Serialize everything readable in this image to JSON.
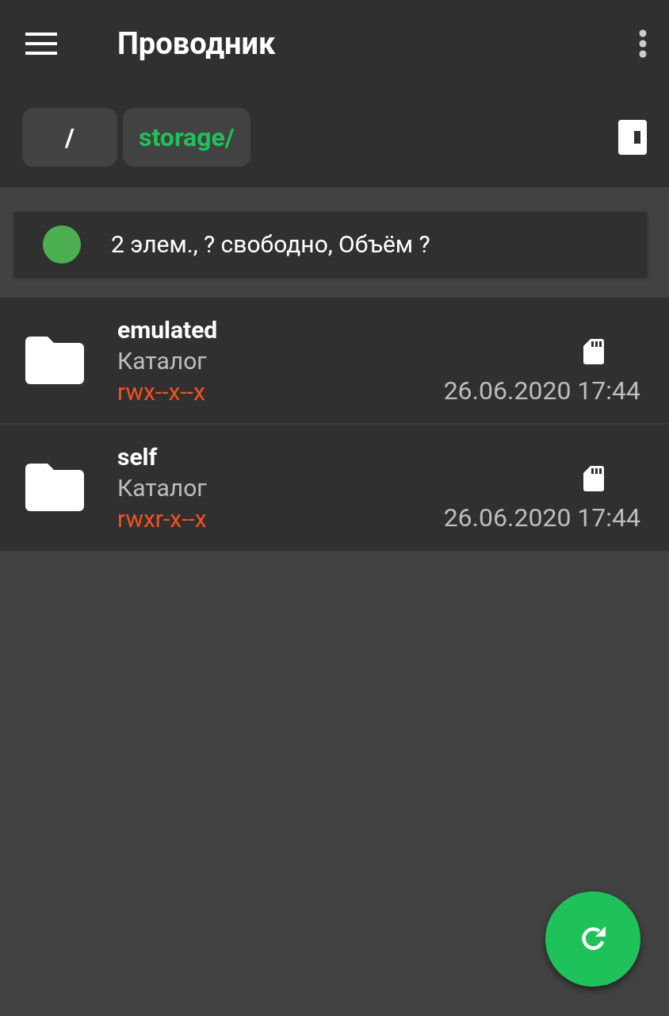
{
  "app_bar": {
    "title": "Проводник"
  },
  "breadcrumbs": [
    {
      "label": "/",
      "selected": false
    },
    {
      "label": "storage/",
      "selected": true
    }
  ],
  "info": {
    "text": "2 элем., ? свободно, Объём ?",
    "color": "#4caf50"
  },
  "files": [
    {
      "name": "emulated",
      "type": "Каталог",
      "permissions": "rwx--x--x",
      "date": "26.06.2020 17:44"
    },
    {
      "name": "self",
      "type": "Каталог",
      "permissions": "rwxr-x--x",
      "date": "26.06.2020 17:44"
    }
  ]
}
